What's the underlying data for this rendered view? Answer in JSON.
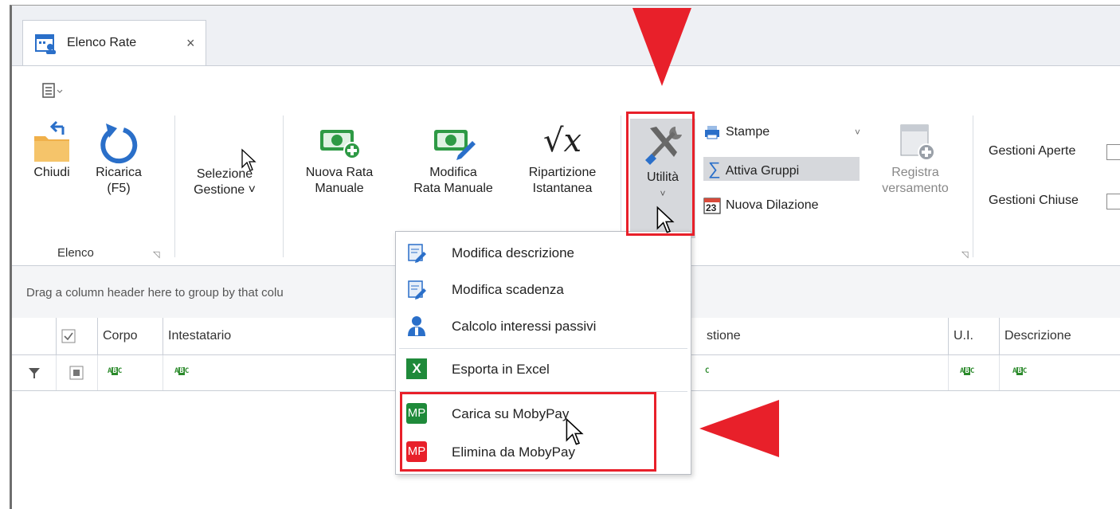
{
  "tab": {
    "title": "Elenco Rate",
    "close": "×"
  },
  "ribbon": {
    "chiudi": "Chiudi",
    "ricarica": "Ricarica\n(F5)",
    "selezione": "Selezione\nGestione ˅",
    "nuova_rata": "Nuova Rata\nManuale",
    "modifica_rata": "Modifica\nRata Manuale",
    "ripartizione": "Ripartizione\nIstantanea",
    "utilita": "Utilità",
    "stampe": "Stampe",
    "attiva_gruppi": "Attiva Gruppi",
    "nuova_dilazione": "Nuova Dilazione",
    "registra": "Registra\nversamento",
    "group_elenco": "Elenco",
    "gestioni_aperte": "Gestioni Aperte",
    "gestioni_chiuse": "Gestioni Chiuse",
    "calendar_day": "23",
    "sqrt_symbol": "√x",
    "sigma": "∑",
    "chevron": "˅"
  },
  "grid": {
    "group_hint": "Drag a column header here to group by that colu",
    "columns": [
      "Corpo",
      "Intestatario",
      "stione",
      "U.I.",
      "Descrizione"
    ]
  },
  "menu": {
    "items": [
      "Modifica descrizione",
      "Modifica scadenza",
      "Calcolo interessi passivi",
      "Esporta in Excel",
      "Carica su MobyPay",
      "Elimina da MobyPay"
    ],
    "mp_badge": "MP",
    "excel_badge": "X"
  },
  "colors": {
    "annotation_red": "#e8202a",
    "mobypay_green": "#1f8a3a",
    "mobypay_red": "#e8202a",
    "icon_blue": "#2a6fc9",
    "money_green": "#2e9a45"
  }
}
